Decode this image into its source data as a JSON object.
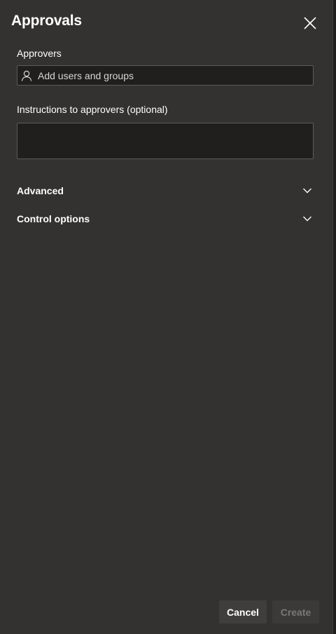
{
  "panel": {
    "title": "Approvals",
    "close_icon": "close-icon"
  },
  "approvers": {
    "label": "Approvers",
    "placeholder": "Add users and groups",
    "icon": "person-icon"
  },
  "instructions": {
    "label": "Instructions to approvers (optional)",
    "value": ""
  },
  "sections": {
    "advanced": "Advanced",
    "control_options": "Control options",
    "icon": "chevron-down-icon"
  },
  "footer": {
    "cancel_label": "Cancel",
    "create_label": "Create",
    "create_enabled": false
  },
  "colors": {
    "panel_bg": "#333230",
    "input_bg": "#201f1e",
    "border": "#5c5b59",
    "text": "#ffffff",
    "disabled_text": "#7a7876"
  }
}
